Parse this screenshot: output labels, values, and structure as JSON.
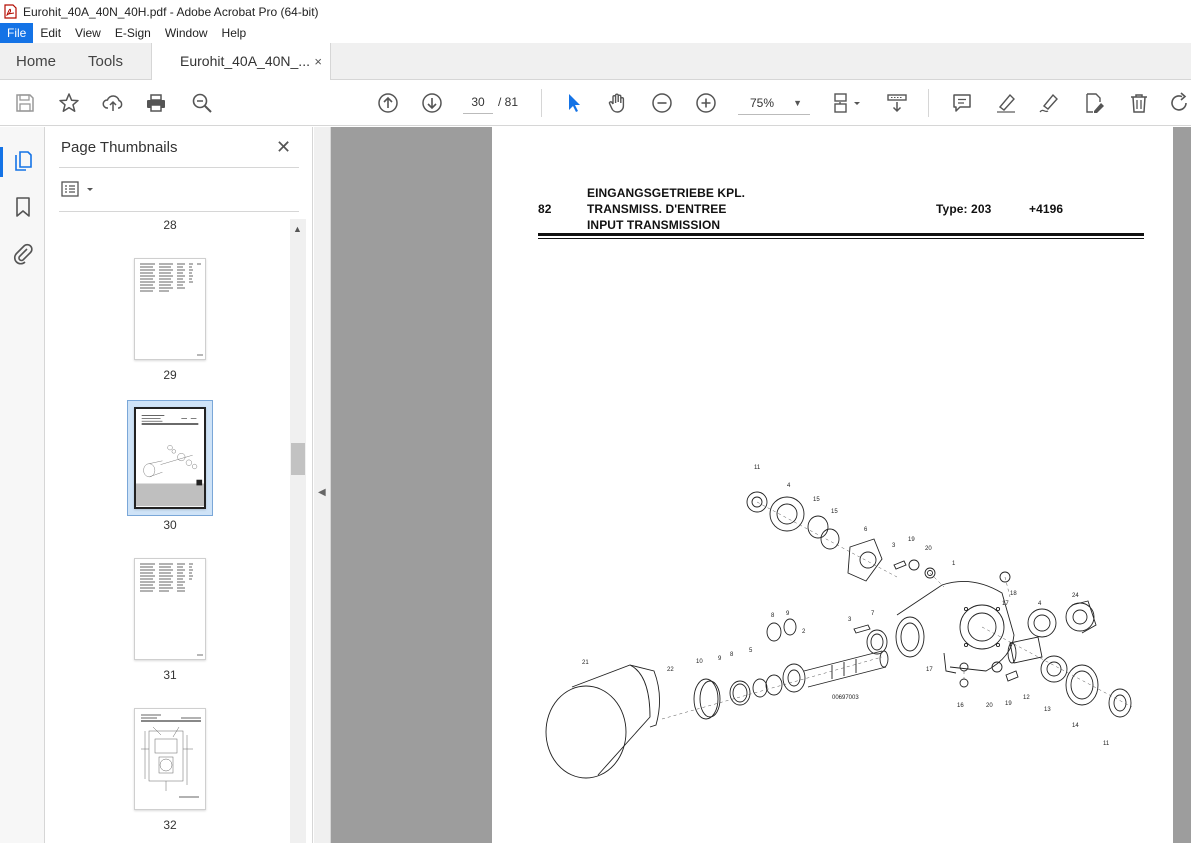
{
  "window": {
    "title": "Eurohit_40A_40N_40H.pdf - Adobe Acrobat Pro (64-bit)"
  },
  "menu": [
    "File",
    "Edit",
    "View",
    "E-Sign",
    "Window",
    "Help"
  ],
  "tabs": {
    "home": "Home",
    "tools": "Tools",
    "document": "Eurohit_40A_40N_...",
    "close": "×"
  },
  "toolbar": {
    "page_current": "30",
    "page_total": "/ 81",
    "zoom": "75%"
  },
  "panel": {
    "title": "Page Thumbnails",
    "close": "✕",
    "thumbnails": [
      {
        "label": "28"
      },
      {
        "label": "29"
      },
      {
        "label": "30"
      },
      {
        "label": "31"
      },
      {
        "label": "32"
      }
    ]
  },
  "document": {
    "page_number": "82",
    "heading_de": "EINGANGSGETRIEBE KPL.",
    "heading_fr": "TRANSMISS. D'ENTREE",
    "heading_en": "INPUT TRANSMISSION",
    "type": "Type: 203",
    "serial": "+4196",
    "drawing_code": "00697003",
    "part_callouts": [
      "11",
      "4",
      "15",
      "15",
      "6",
      "3",
      "19",
      "20",
      "1",
      "17",
      "18",
      "4",
      "24",
      "9",
      "8",
      "7",
      "2",
      "3",
      "21",
      "22",
      "10",
      "9",
      "8",
      "5",
      "17",
      "16",
      "20",
      "19",
      "12",
      "13",
      "14",
      "11"
    ]
  },
  "colors": {
    "accent": "#1473e6",
    "doc_background": "#9d9d9d",
    "selection": "#cfe3f7"
  }
}
